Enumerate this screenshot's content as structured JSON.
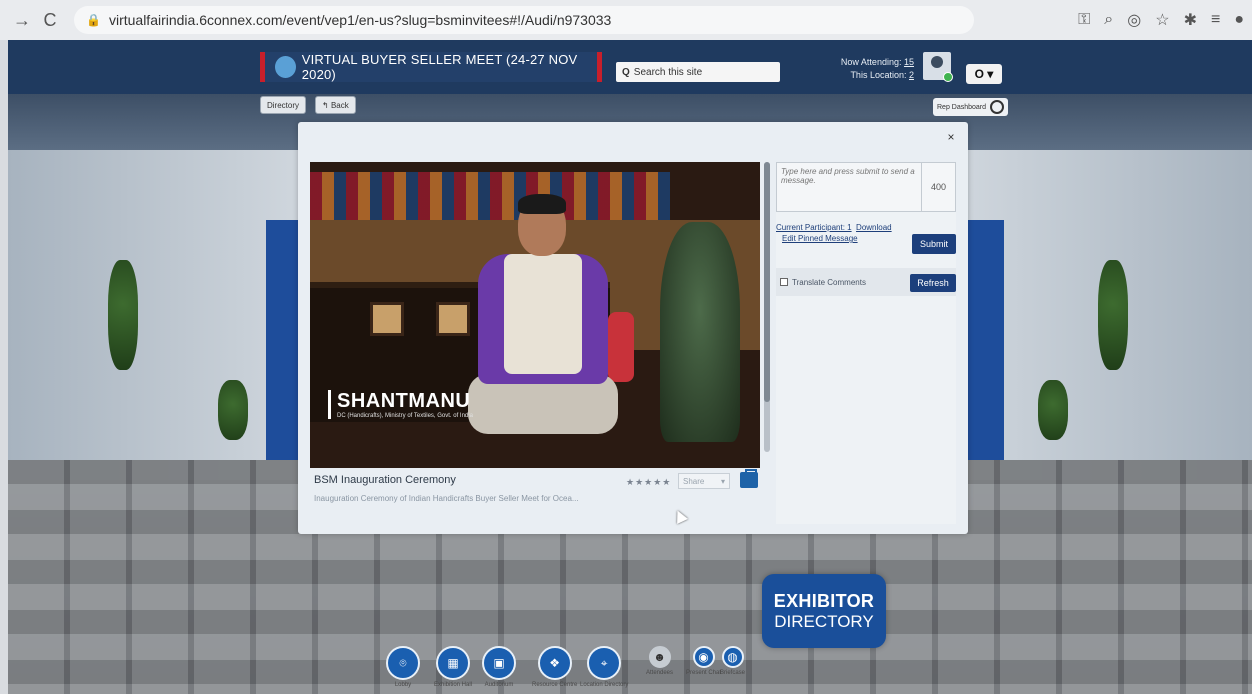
{
  "browser": {
    "url": "virtualfairindia.6connex.com/event/vep1/en-us?slug=bsminvitees#!/Audi/n973033"
  },
  "header": {
    "brand_title": "VIRTUAL BUYER SELLER MEET (24-27 NOV 2020)",
    "search_placeholder": "Search this site",
    "now_attending_label": "Now Attending:",
    "now_attending_value": "15",
    "this_location_label": "This Location:",
    "this_location_value": "2",
    "settings_label": "O ▾",
    "directory_label": "Directory",
    "back_label": "Back",
    "rep_dashboard_label": "Rep Dashboard"
  },
  "video": {
    "presenter_name": "SHANTMANU",
    "presenter_designation": "DC (Handicrafts), Ministry of Textiles, Govt. of India",
    "title": "BSM Inauguration Ceremony",
    "description": "Inauguration Ceremony of Indian Handicrafts Buyer Seller Meet for Ocea...",
    "rating_stars": "★★★★★",
    "share_label": "Share"
  },
  "chat": {
    "message_placeholder": "Type here and press submit to send a message.",
    "char_count": "400",
    "current_participant": "Current Participant: 1",
    "download_label": "Download",
    "edit_pinned_label": "Edit Pinned Message",
    "submit_label": "Submit",
    "translate_label": "Translate Comments",
    "refresh_label": "Refresh"
  },
  "exhibitor": {
    "line1": "EXHIBITOR",
    "line2": "DIRECTORY"
  },
  "dock": [
    {
      "label": "Lobby"
    },
    {
      "label": "Exhibition Hall"
    },
    {
      "label": "Auditorium"
    },
    {
      "label": "Resource Centre"
    },
    {
      "label": "Location Directory"
    },
    {
      "label": "Attendees"
    },
    {
      "label": "Present Chat"
    },
    {
      "label": "Briefcase"
    }
  ],
  "close_label": "×"
}
